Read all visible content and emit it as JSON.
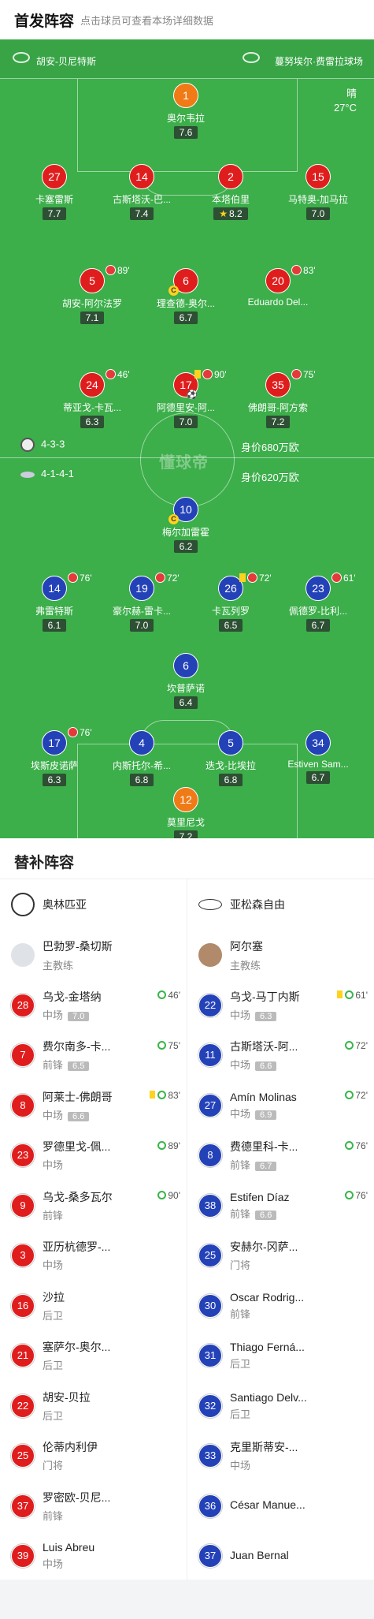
{
  "header": {
    "title": "首发阵容",
    "subtitle": "点击球员可查看本场详细数据"
  },
  "pitch": {
    "home_team": "胡安-贝尼特斯",
    "away_team": "蔓努埃尔·费雷拉球场",
    "weather": "晴",
    "temperature": "27°C",
    "watermark": "懂球帝",
    "home_formation": "4-3-3",
    "home_value": "身价680万欧",
    "away_formation": "4-1-4-1",
    "away_value": "身价620万欧"
  },
  "players": [
    {
      "num": "1",
      "name": "奥尔韦拉",
      "rating": "7.6",
      "team": "gk"
    },
    {
      "num": "27",
      "name": "卡塞雷斯",
      "rating": "7.7",
      "team": "red"
    },
    {
      "num": "14",
      "name": "古斯塔沃-巴...",
      "rating": "7.4",
      "team": "red"
    },
    {
      "num": "2",
      "name": "本塔伯里",
      "rating": "8.2",
      "team": "red",
      "star": true
    },
    {
      "num": "15",
      "name": "马特奥-加马拉",
      "rating": "7.0",
      "team": "red"
    },
    {
      "num": "5",
      "name": "胡安-阿尔法罗",
      "rating": "7.1",
      "team": "red",
      "sub": "89'"
    },
    {
      "num": "6",
      "name": "理查德-奥尔...",
      "rating": "6.7",
      "team": "red",
      "captain": "C"
    },
    {
      "num": "20",
      "name": "Eduardo Del...",
      "rating": "",
      "team": "red",
      "sub": "83'"
    },
    {
      "num": "24",
      "name": "蒂亚戈-卡瓦...",
      "rating": "6.3",
      "team": "red",
      "sub": "46'"
    },
    {
      "num": "17",
      "name": "阿德里安-阿...",
      "rating": "7.0",
      "team": "red",
      "sub": "90'",
      "yellow": true,
      "goal": true
    },
    {
      "num": "35",
      "name": "佛朗哥-阿方索",
      "rating": "7.2",
      "team": "red",
      "sub": "75'"
    },
    {
      "num": "10",
      "name": "梅尔加雷霍",
      "rating": "6.2",
      "team": "blue",
      "captain": "C"
    },
    {
      "num": "14",
      "name": "弗雷特斯",
      "rating": "6.1",
      "team": "blue",
      "sub": "76'"
    },
    {
      "num": "19",
      "name": "豪尔赫-雷卡...",
      "rating": "7.0",
      "team": "blue",
      "sub": "72'"
    },
    {
      "num": "26",
      "name": "卡瓦列罗",
      "rating": "6.5",
      "team": "blue",
      "sub": "72'",
      "yellow": true
    },
    {
      "num": "23",
      "name": "佩德罗-比利...",
      "rating": "6.7",
      "team": "blue",
      "sub": "61'"
    },
    {
      "num": "6",
      "name": "坎普萨诺",
      "rating": "6.4",
      "team": "blue"
    },
    {
      "num": "17",
      "name": "埃斯皮诺萨",
      "rating": "6.3",
      "team": "blue",
      "sub": "76'"
    },
    {
      "num": "4",
      "name": "内斯托尔-希...",
      "rating": "6.8",
      "team": "blue"
    },
    {
      "num": "5",
      "name": "迭戈-比埃拉",
      "rating": "6.8",
      "team": "blue"
    },
    {
      "num": "34",
      "name": "Estiven Sam...",
      "rating": "6.7",
      "team": "blue"
    },
    {
      "num": "12",
      "name": "莫里尼戈",
      "rating": "7.2",
      "team": "gk"
    }
  ],
  "bench": {
    "title": "替补阵容",
    "home": {
      "team": "奥林匹亚",
      "coach": "巴勃罗-桑切斯",
      "coach_role": "主教练",
      "players": [
        {
          "num": "28",
          "name": "乌戈-金塔纳",
          "pos": "中场",
          "rating": "7.0",
          "event": "46'"
        },
        {
          "num": "7",
          "name": "费尔南多-卡...",
          "pos": "前锋",
          "rating": "6.5",
          "event": "75'"
        },
        {
          "num": "8",
          "name": "阿莱士-佛朗哥",
          "pos": "中场",
          "rating": "6.6",
          "event": "83'",
          "yellow": true
        },
        {
          "num": "23",
          "name": "罗德里戈-佩...",
          "pos": "中场",
          "rating": "",
          "event": "89'"
        },
        {
          "num": "9",
          "name": "乌戈-桑多瓦尔",
          "pos": "前锋",
          "rating": "",
          "event": "90'"
        },
        {
          "num": "3",
          "name": "亚历杭德罗-...",
          "pos": "中场",
          "rating": "",
          "event": ""
        },
        {
          "num": "16",
          "name": "沙拉",
          "pos": "后卫",
          "rating": "",
          "event": ""
        },
        {
          "num": "21",
          "name": "塞萨尔-奥尔...",
          "pos": "后卫",
          "rating": "",
          "event": ""
        },
        {
          "num": "22",
          "name": "胡安-贝拉",
          "pos": "后卫",
          "rating": "",
          "event": ""
        },
        {
          "num": "25",
          "name": "伦蒂内利伊",
          "pos": "门将",
          "rating": "",
          "event": ""
        },
        {
          "num": "37",
          "name": "罗密欧-贝尼...",
          "pos": "前锋",
          "rating": "",
          "event": ""
        },
        {
          "num": "39",
          "name": "Luis Abreu",
          "pos": "中场",
          "rating": "",
          "event": ""
        }
      ]
    },
    "away": {
      "team": "亚松森自由",
      "coach": "阿尔塞",
      "coach_role": "主教练",
      "players": [
        {
          "num": "22",
          "name": "乌戈-马丁内斯",
          "pos": "中场",
          "rating": "6.3",
          "event": "61'",
          "yellow": true
        },
        {
          "num": "11",
          "name": "古斯塔沃-阿...",
          "pos": "中场",
          "rating": "6.6",
          "event": "72'"
        },
        {
          "num": "27",
          "name": "Amín Molinas",
          "pos": "中场",
          "rating": "6.9",
          "event": "72'"
        },
        {
          "num": "8",
          "name": "费德里科-卡...",
          "pos": "前锋",
          "rating": "6.7",
          "event": "76'"
        },
        {
          "num": "38",
          "name": "Estifen Díaz",
          "pos": "前锋",
          "rating": "6.6",
          "event": "76'"
        },
        {
          "num": "25",
          "name": "安赫尔-冈萨...",
          "pos": "门将",
          "rating": "",
          "event": ""
        },
        {
          "num": "30",
          "name": "Oscar Rodrig...",
          "pos": "前锋",
          "rating": "",
          "event": ""
        },
        {
          "num": "31",
          "name": "Thiago Ferná...",
          "pos": "后卫",
          "rating": "",
          "event": ""
        },
        {
          "num": "32",
          "name": "Santiago Delv...",
          "pos": "后卫",
          "rating": "",
          "event": ""
        },
        {
          "num": "33",
          "name": "克里斯蒂安-...",
          "pos": "中场",
          "rating": "",
          "event": ""
        },
        {
          "num": "36",
          "name": "César Manue...",
          "pos": "",
          "rating": "",
          "event": ""
        },
        {
          "num": "37",
          "name": "Juan Bernal",
          "pos": "",
          "rating": "",
          "event": ""
        }
      ]
    }
  }
}
